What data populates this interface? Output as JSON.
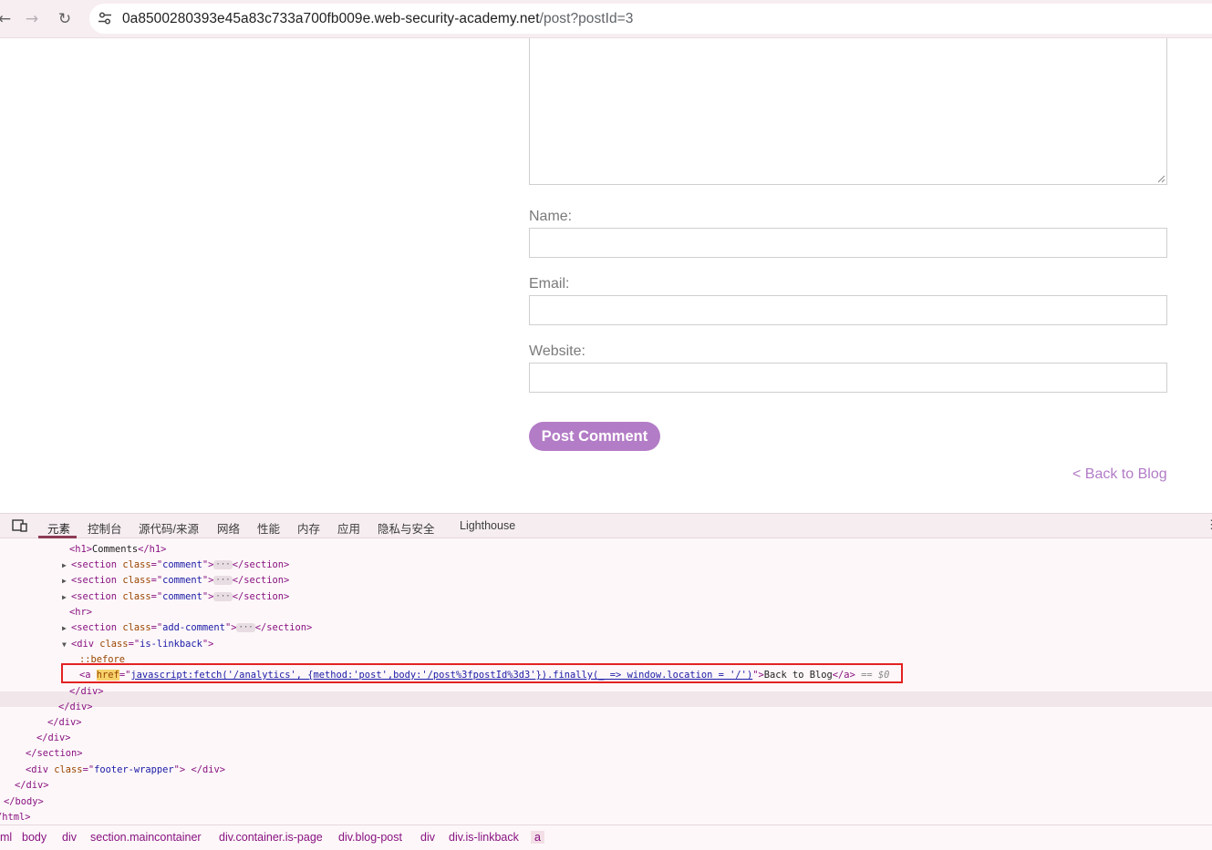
{
  "browser": {
    "url_host": "0a8500280393e45a83c733a700fb009e.web-security-academy.net",
    "url_path": "/post?postId=3",
    "back_icon": "arrow-left-icon",
    "forward_icon": "arrow-right-icon",
    "reload_icon": "reload-icon",
    "site_info_icon": "tune-icon"
  },
  "form": {
    "name_label": "Name:",
    "email_label": "Email:",
    "website_label": "Website:",
    "comment_value": "",
    "name_value": "",
    "email_value": "",
    "website_value": "",
    "submit_label": "Post Comment",
    "back_link": "< Back to Blog",
    "accent_color": "#b37cc6"
  },
  "devtools": {
    "tabs": [
      "元素",
      "控制台",
      "源代码/来源",
      "网络",
      "性能",
      "内存",
      "应用",
      "隐私与安全",
      "Lighthouse"
    ],
    "active_tab": "元素",
    "dom": {
      "h1": "Comments",
      "section_class_1": "comment",
      "section_class_2": "comment",
      "section_class_3": "comment",
      "add_comment_class": "add-comment",
      "linkback_class": "is-linkback",
      "before_pseudo": "::before",
      "href_attr": "href",
      "href_value": "javascript:fetch('/analytics', {method:'post',body:'/post%3fpostId%3d3'}).finally(_ => window.location = '/')",
      "link_text": "Back to Blog",
      "selected_marker": "== $0",
      "footer_class": "footer-wrapper"
    },
    "breadcrumbs": [
      "ml",
      "body",
      "div",
      "section.maincontainer",
      "div.container.is-page",
      "div.blog-post",
      "div",
      "div.is-linkback",
      "a"
    ]
  }
}
